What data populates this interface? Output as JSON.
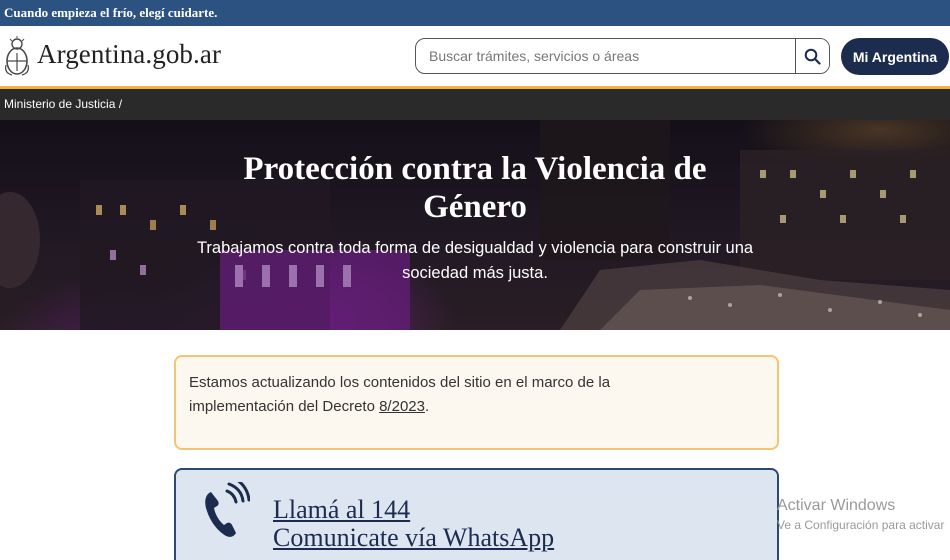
{
  "top_banner": {
    "text": "Cuando empieza el frío, elegí cuidarte."
  },
  "header": {
    "site_name": "Argentina.gob.ar",
    "search_placeholder": "Buscar trámites, servicios o áreas",
    "mi_argentina_label": "Mi Argentina"
  },
  "breadcrumb": {
    "item": "Ministerio de Justicia",
    "separator": "/"
  },
  "hero": {
    "title_line1": "Protección contra la Violencia de",
    "title_line2": "Género",
    "subtitle_line1": "Trabajamos contra toda forma de desigualdad y violencia para construir una",
    "subtitle_line2": "sociedad más justa."
  },
  "notice": {
    "text_line1": "Estamos actualizando los contenidos del sitio en el marco de la",
    "text_line2_prefix": "implementación del Decreto ",
    "decree_link": "8/2023",
    "text_line2_suffix": "."
  },
  "contact": {
    "call_label": "Llamá al 144",
    "whatsapp_label": "Comunicate vía WhatsApp",
    "icon": "phone-icon"
  },
  "watermark": {
    "title": "Activar Windows",
    "subtitle": "Ve a Configuración para activar"
  },
  "colors": {
    "banner": "#2c5282",
    "mi_argentina": "#1b2c4f",
    "accent": "#f3b23b",
    "breadcrumb_bar": "#2a2a2a",
    "notice_border": "#f3c573",
    "contact_border": "#2b4a6f"
  }
}
